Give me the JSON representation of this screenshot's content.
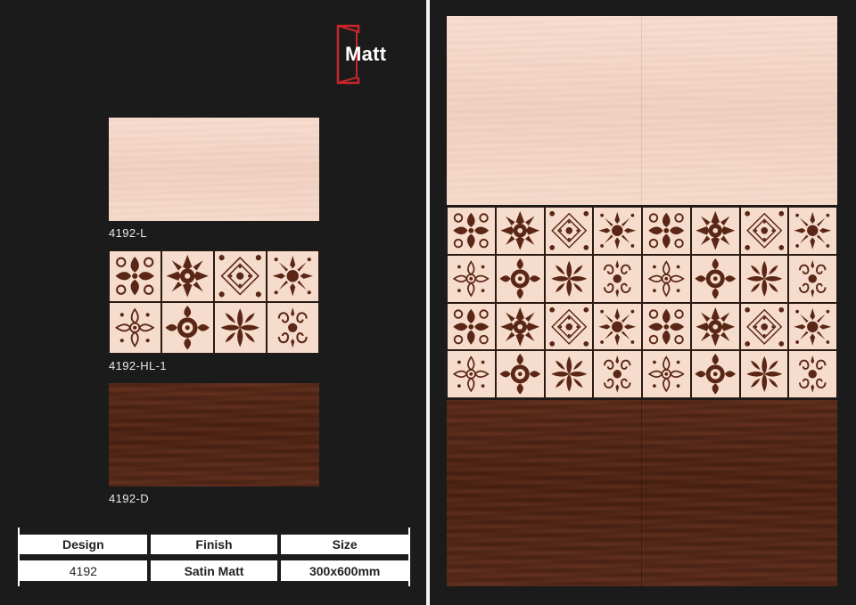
{
  "brand": {
    "logo_text": "Matt"
  },
  "swatches": [
    {
      "code": "4192-L"
    },
    {
      "code": "4192-HL-1"
    },
    {
      "code": "4192-D"
    }
  ],
  "spec_table": {
    "headers": [
      "Design",
      "Finish",
      "Size"
    ],
    "values": [
      "4192",
      "Satin Matt",
      "300x600mm"
    ]
  },
  "colors": {
    "background": "#1b1b1c",
    "light_tile": "#f4d6c7",
    "dark_tile": "#4f2415",
    "motif": "#5a2616",
    "logo_accent": "#c8262b"
  },
  "icons": [
    "door-logo-icon"
  ]
}
